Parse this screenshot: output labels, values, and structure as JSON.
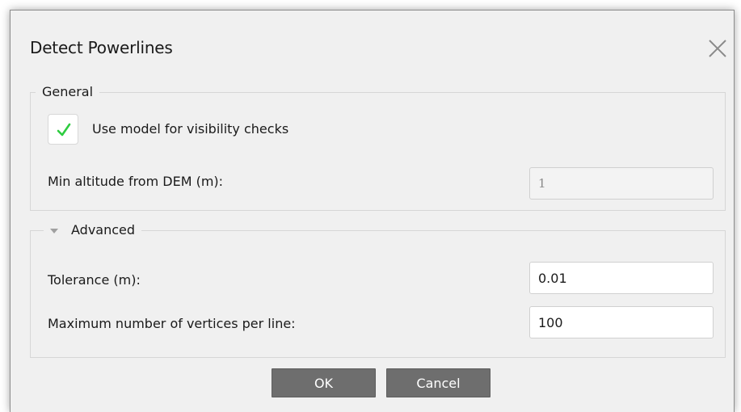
{
  "dialog": {
    "title": "Detect Powerlines",
    "close_icon": "close-icon"
  },
  "general": {
    "title": "General",
    "use_model": {
      "label": "Use model for visibility checks",
      "checked": true,
      "check_color": "#2ecc40"
    },
    "min_altitude": {
      "label": "Min altitude from DEM (m):",
      "value": "1",
      "disabled": true
    }
  },
  "advanced": {
    "title": "Advanced",
    "expanded": true,
    "tolerance": {
      "label": "Tolerance (m):",
      "value": "0.01"
    },
    "max_vertices": {
      "label": "Maximum number of vertices per line:",
      "value": "100"
    }
  },
  "buttons": {
    "ok": "OK",
    "cancel": "Cancel"
  }
}
